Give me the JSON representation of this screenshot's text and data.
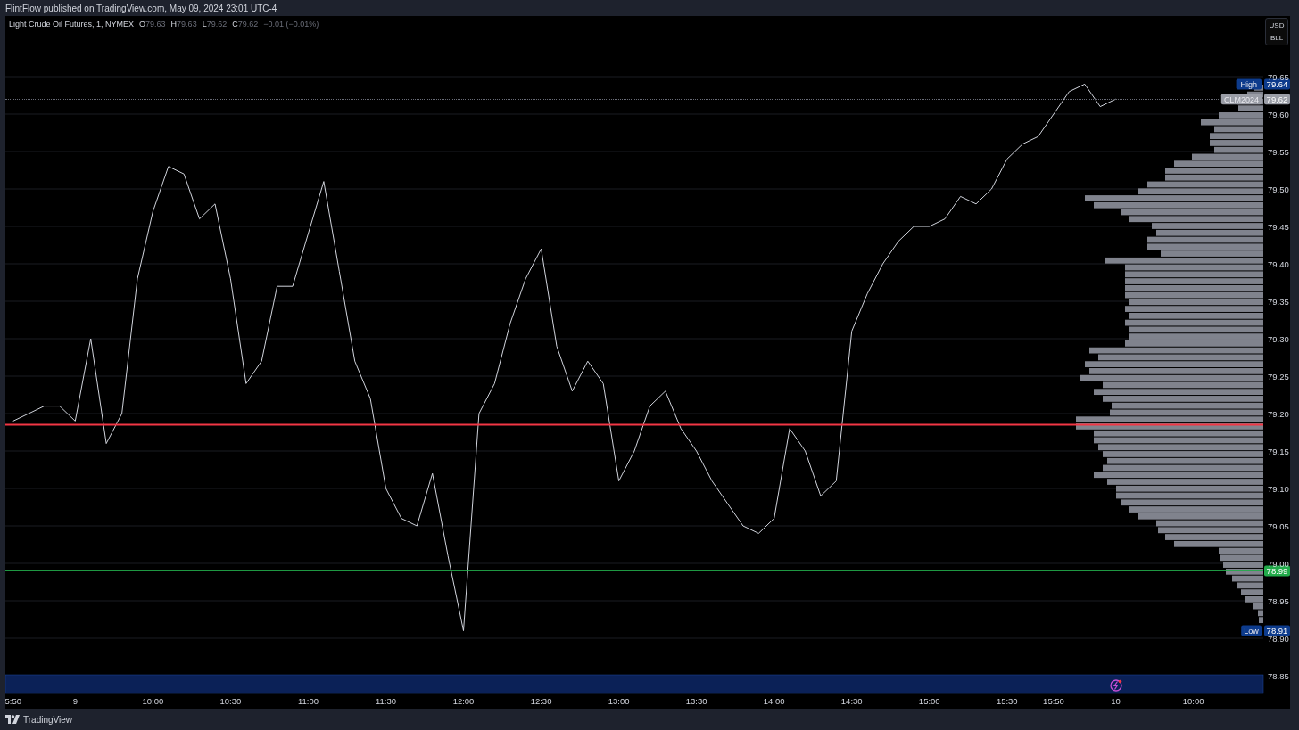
{
  "header": {
    "caption": "FlintFlow published on TradingView.com, May 09, 2024 23:01 UTC-4"
  },
  "legend": {
    "title": "Light Crude Oil Futures, 1, NYMEX",
    "ohlc": [
      {
        "label": "O",
        "value": "79.63"
      },
      {
        "label": "H",
        "value": "79.63"
      },
      {
        "label": "L",
        "value": "79.62"
      },
      {
        "label": "C",
        "value": "79.62"
      }
    ],
    "change": "−0.01 (−0.01%)"
  },
  "scale_panel": {
    "currency": "USD",
    "unit": "BLL"
  },
  "chart": {
    "chart_data": {
      "type": "line",
      "grid": true,
      "ylim": [
        78.85,
        79.65
      ],
      "categories": [
        "5:50",
        null,
        null,
        null,
        "9",
        null,
        null,
        null,
        null,
        "10:00",
        null,
        null,
        null,
        null,
        "10:30",
        null,
        null,
        null,
        null,
        "11:00",
        null,
        null,
        null,
        null,
        "11:30",
        null,
        null,
        null,
        null,
        "12:00",
        null,
        null,
        null,
        null,
        "12:30",
        null,
        null,
        null,
        null,
        "13:00",
        null,
        null,
        null,
        null,
        "13:30",
        null,
        null,
        null,
        null,
        "14:00",
        null,
        null,
        null,
        null,
        "14:30",
        null,
        null,
        null,
        null,
        "15:00",
        null,
        null,
        null,
        null,
        "15:30",
        null,
        null,
        "15:50",
        null,
        null,
        null,
        "10",
        null,
        null,
        null,
        null,
        "10:00",
        null,
        null,
        null,
        null
      ],
      "series": [
        {
          "color": "#d1d4dc",
          "values": [
            79.19,
            79.2,
            79.21,
            79.21,
            79.19,
            79.3,
            79.16,
            79.2,
            79.38,
            79.47,
            79.53,
            79.52,
            79.46,
            79.48,
            79.38,
            79.24,
            79.27,
            79.37,
            79.37,
            79.44,
            79.51,
            79.39,
            79.27,
            79.22,
            79.1,
            79.06,
            79.05,
            79.12,
            79.01,
            78.91,
            79.2,
            79.24,
            79.32,
            79.38,
            79.42,
            79.29,
            79.23,
            79.27,
            79.24,
            79.11,
            79.15,
            79.21,
            79.23,
            79.18,
            79.15,
            79.11,
            79.08,
            79.05,
            79.04,
            79.06,
            79.18,
            79.15,
            79.09,
            79.11,
            79.31,
            79.36,
            79.4,
            79.43,
            79.45,
            79.45,
            79.46,
            79.49,
            79.48,
            79.5,
            79.54,
            79.56,
            79.57,
            79.6,
            79.63,
            79.64,
            79.61,
            79.62,
            null,
            null,
            null,
            null,
            null,
            null,
            null,
            null,
            null
          ]
        }
      ],
      "yticks": [
        {
          "value": 79.65,
          "label": "79.65"
        },
        {
          "value": 79.6,
          "label": "79.60"
        },
        {
          "value": 79.55,
          "label": "79.55"
        },
        {
          "value": 79.5,
          "label": "79.50"
        },
        {
          "value": 79.45,
          "label": "79.45"
        },
        {
          "value": 79.4,
          "label": "79.40"
        },
        {
          "value": 79.35,
          "label": "79.35"
        },
        {
          "value": 79.3,
          "label": "79.30"
        },
        {
          "value": 79.25,
          "label": "79.25"
        },
        {
          "value": 79.2,
          "label": "79.20"
        },
        {
          "value": 79.15,
          "label": "79.15"
        },
        {
          "value": 79.1,
          "label": "79.10"
        },
        {
          "value": 79.05,
          "label": "79.05"
        },
        {
          "value": 79.0,
          "label": "79.00"
        },
        {
          "value": 78.95,
          "label": "78.95"
        },
        {
          "value": 78.9,
          "label": "78.90"
        },
        {
          "value": 78.85,
          "label": "78.85"
        }
      ],
      "ref_lines": [
        {
          "axis": "y",
          "value": 79.185,
          "color": "#f23645"
        },
        {
          "axis": "y",
          "value": 78.99,
          "color": "#22ab4a",
          "label": "78.99"
        }
      ]
    },
    "price_badges": [
      {
        "kind": "high",
        "name": "High",
        "value": "79.64"
      },
      {
        "kind": "current",
        "name": "CLM2024",
        "value": "79.62"
      },
      {
        "kind": "low",
        "name": "Low",
        "value": "78.91"
      }
    ]
  },
  "footer": {
    "brand": "TradingView"
  }
}
